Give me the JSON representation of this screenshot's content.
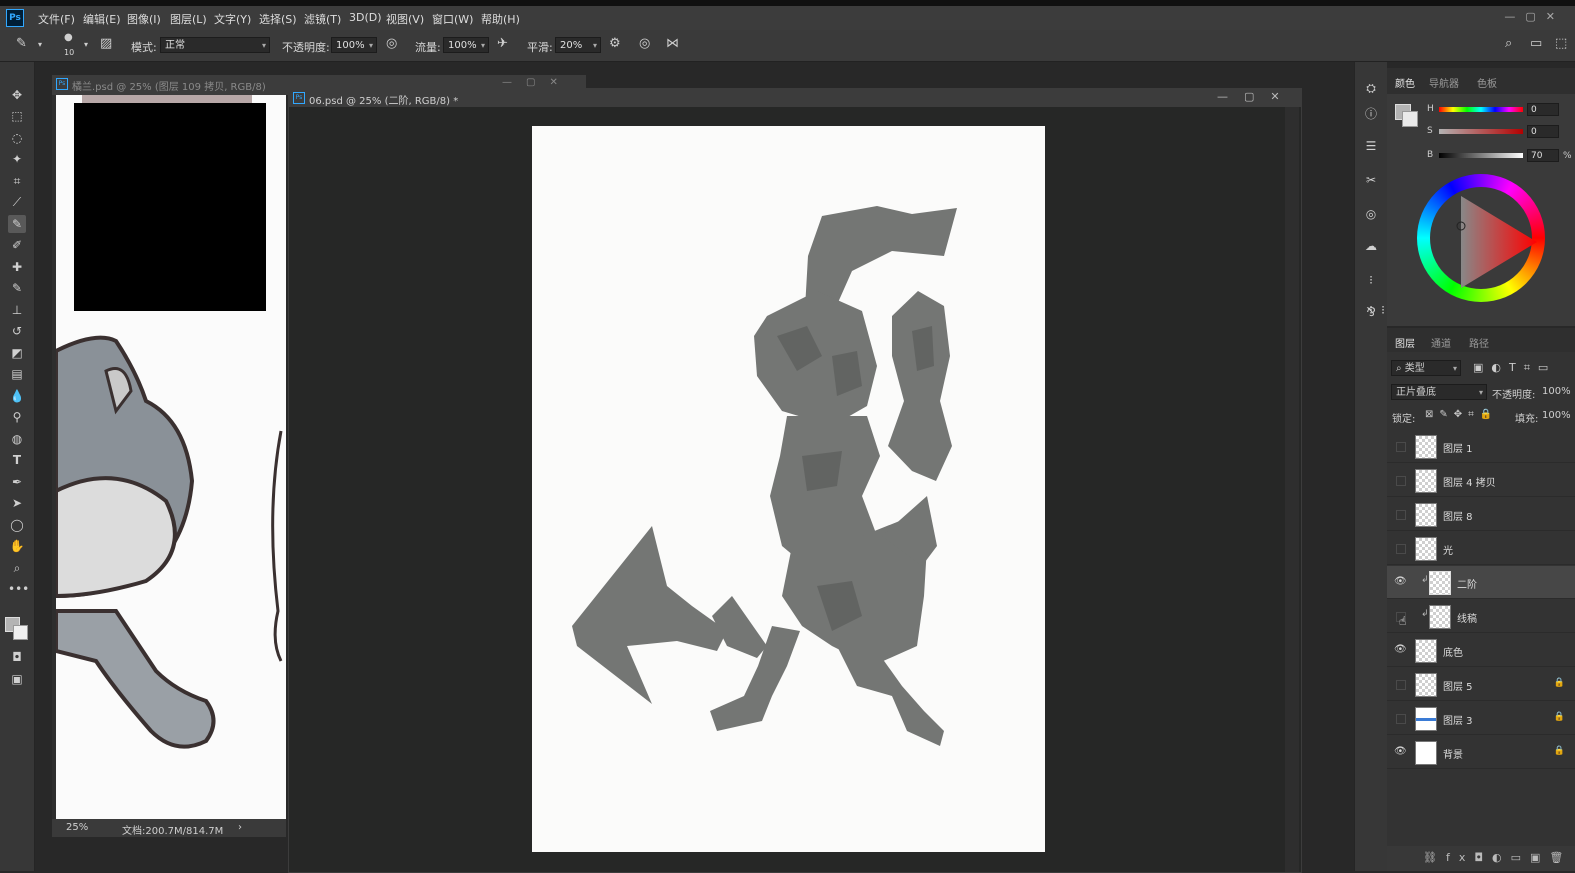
{
  "menu": [
    "文件(F)",
    "编辑(E)",
    "图像(I)",
    "图层(L)",
    "文字(Y)",
    "选择(S)",
    "滤镜(T)",
    "3D(D)",
    "视图(V)",
    "窗口(W)",
    "帮助(H)"
  ],
  "app_logo": "Ps",
  "options": {
    "brush_size": "10",
    "mode_label": "模式:",
    "mode_value": "正常",
    "opacity_label": "不透明度:",
    "opacity_value": "100%",
    "flow_label": "流量:",
    "flow_value": "100%",
    "smooth_label": "平滑:",
    "smooth_value": "20%"
  },
  "doc1": {
    "title": "橘兰.psd @ 25% (图层 109 拷贝, RGB/8)",
    "zoom": "25%",
    "doc_size": "文档:200.7M/814.7M"
  },
  "doc2": {
    "title": "06.psd @ 25% (二阶, RGB/8) *"
  },
  "color_panel": {
    "tabs": [
      "颜色",
      "导航器",
      "色板"
    ],
    "h_label": "H",
    "h_value": "0",
    "s_label": "S",
    "s_value": "0",
    "b_label": "B",
    "b_value": "70",
    "pct": "%"
  },
  "layers_panel": {
    "tabs": [
      "图层",
      "通道",
      "路径"
    ],
    "filter_label": "类型",
    "blend_mode": "正片叠底",
    "opacity_label": "不透明度:",
    "opacity_value": "100%",
    "lock_label": "锁定:",
    "fill_label": "填充:",
    "fill_value": "100%",
    "layers": [
      {
        "name": "图层 1",
        "visible": false
      },
      {
        "name": "图层 4 拷贝",
        "visible": false
      },
      {
        "name": "图层 8",
        "visible": false
      },
      {
        "name": "光",
        "visible": false
      },
      {
        "name": "二阶",
        "visible": true,
        "selected": true,
        "clipped": true
      },
      {
        "name": "线稿",
        "visible": false,
        "clipped": true
      },
      {
        "name": "底色",
        "visible": true
      },
      {
        "name": "图层 5",
        "visible": false,
        "locked": true
      },
      {
        "name": "图层 3",
        "visible": false,
        "locked": true
      },
      {
        "name": "背景",
        "visible": true,
        "locked": true
      }
    ]
  },
  "colors": {
    "silhouette": "#747674",
    "canvas_bg": "#282828"
  }
}
